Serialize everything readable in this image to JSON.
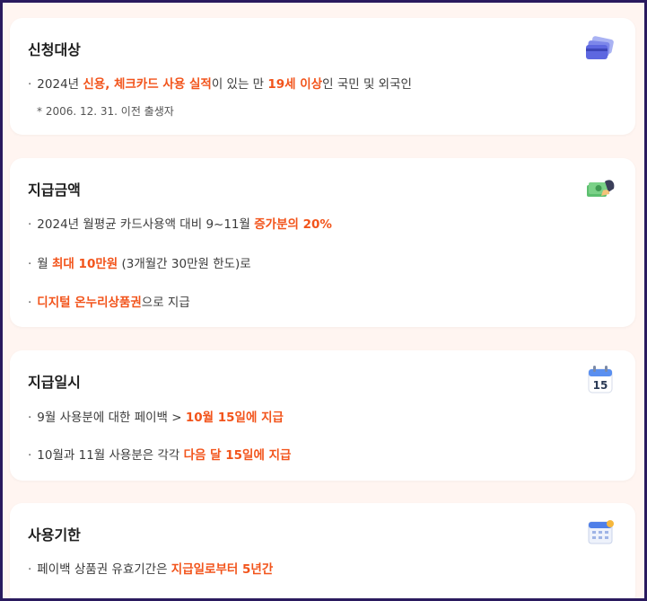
{
  "sections": [
    {
      "title": "신청대상",
      "icon": "credit-cards-icon",
      "lines": [
        {
          "parts": [
            "2024년 ",
            "신용, 체크카드 사용 실적",
            "이 있는 만 ",
            "19세 이상",
            "인 국민 및 외국인"
          ]
        }
      ],
      "note": "* 2006. 12. 31. 이전 출생자"
    },
    {
      "title": "지급금액",
      "icon": "money-hand-icon",
      "lines": [
        {
          "parts": [
            "2024년 월평균 카드사용액 대비 9~11월 ",
            "증가분의 20%"
          ]
        },
        {
          "parts": [
            "월 ",
            "최대 10만원",
            " (3개월간 30만원 한도)로"
          ]
        },
        {
          "parts": [
            "",
            "디지털 온누리상품권",
            "으로 지급"
          ]
        }
      ]
    },
    {
      "title": "지급일시",
      "icon": "calendar-15-icon",
      "calendar_day": "15",
      "lines": [
        {
          "parts": [
            "9월 사용분에 대한 페이백 > ",
            "10월 15일에 지급"
          ]
        },
        {
          "parts": [
            "10월과 11월 사용분은 각각 ",
            "다음 달 15일에 지급"
          ]
        }
      ]
    },
    {
      "title": "사용기한",
      "icon": "calendar-icon",
      "lines": [
        {
          "parts": [
            "페이백 상품권 유효기간은 ",
            "지급일로부터 5년간"
          ]
        }
      ]
    }
  ],
  "colors": {
    "accent": "#f2541b",
    "background": "#fff5f1",
    "card": "#ffffff"
  }
}
